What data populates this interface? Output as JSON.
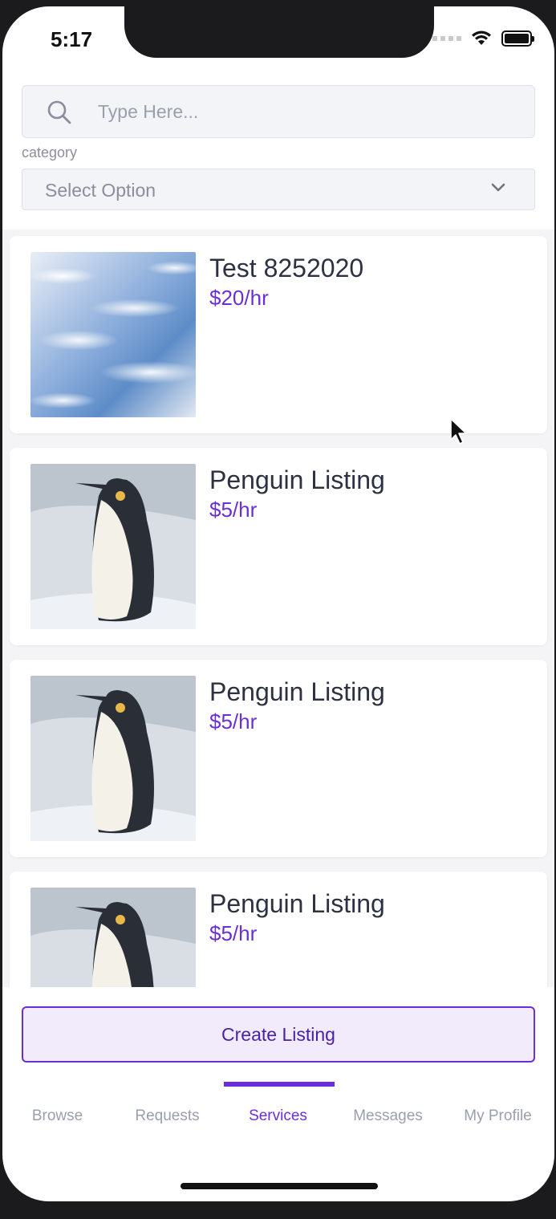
{
  "status_bar": {
    "time": "5:17"
  },
  "search": {
    "placeholder": "Type Here..."
  },
  "filter": {
    "label": "category",
    "selected": "Select Option"
  },
  "listings": [
    {
      "title": "Test 8252020",
      "price": "$20/hr",
      "image": "sky-clouds"
    },
    {
      "title": "Penguin Listing",
      "price": "$5/hr",
      "image": "penguin"
    },
    {
      "title": "Penguin Listing",
      "price": "$5/hr",
      "image": "penguin"
    },
    {
      "title": "Penguin Listing",
      "price": "$5/hr",
      "image": "penguin"
    }
  ],
  "actions": {
    "create_label": "Create Listing"
  },
  "tabs": [
    {
      "label": "Browse",
      "active": false
    },
    {
      "label": "Requests",
      "active": false
    },
    {
      "label": "Services",
      "active": true
    },
    {
      "label": "Messages",
      "active": false
    },
    {
      "label": "My Profile",
      "active": false
    }
  ],
  "colors": {
    "accent": "#6a2fd6",
    "muted": "#9a9fae",
    "title": "#2e3142"
  }
}
